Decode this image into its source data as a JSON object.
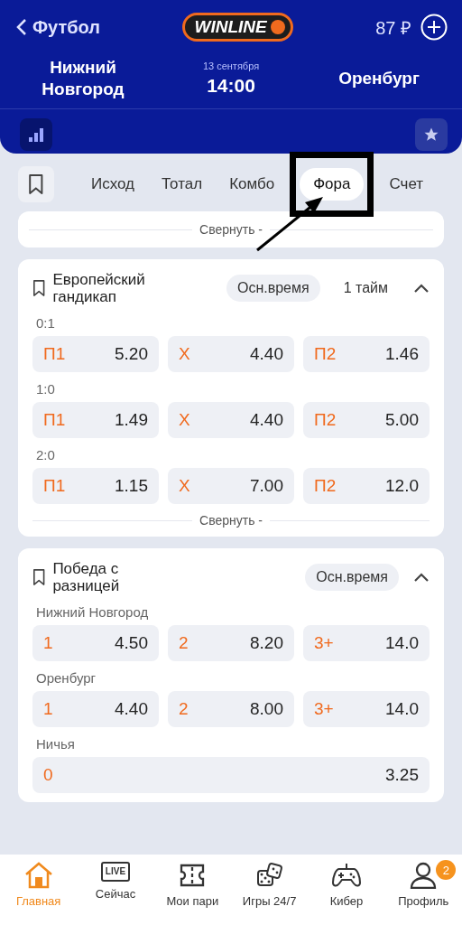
{
  "header": {
    "back_label": "Футбол",
    "logo": "WINLINE",
    "balance": "87 ₽",
    "home_team": "Нижний Новгород",
    "date": "13 сентября",
    "time": "14:00",
    "away_team": "Оренбург"
  },
  "tabs": [
    {
      "label": "Исход",
      "selected": false
    },
    {
      "label": "Тотал",
      "selected": false
    },
    {
      "label": "Комбо",
      "selected": false
    },
    {
      "label": "Фора",
      "selected": true
    },
    {
      "label": "Счет",
      "selected": false
    }
  ],
  "collapsed_card": {
    "collapse_label": "Свернуть -"
  },
  "markets": [
    {
      "title": "Европейский гандикап",
      "expanded": true,
      "periods": [
        {
          "label": "Осн.время",
          "selected": true
        },
        {
          "label": "1 тайм",
          "selected": false
        }
      ],
      "collapse_label": "Свернуть -",
      "groups": [
        {
          "label": "0:1",
          "outcomes": [
            {
              "name": "П1",
              "odd": "5.20"
            },
            {
              "name": "Х",
              "odd": "4.40"
            },
            {
              "name": "П2",
              "odd": "1.46"
            }
          ]
        },
        {
          "label": "1:0",
          "outcomes": [
            {
              "name": "П1",
              "odd": "1.49"
            },
            {
              "name": "Х",
              "odd": "4.40"
            },
            {
              "name": "П2",
              "odd": "5.00"
            }
          ]
        },
        {
          "label": "2:0",
          "outcomes": [
            {
              "name": "П1",
              "odd": "1.15"
            },
            {
              "name": "Х",
              "odd": "7.00"
            },
            {
              "name": "П2",
              "odd": "12.0"
            }
          ]
        }
      ]
    },
    {
      "title": "Победа с разницей",
      "expanded": true,
      "periods": [
        {
          "label": "Осн.время",
          "selected": true
        }
      ],
      "groups": [
        {
          "label": "Нижний Новгород",
          "outcomes": [
            {
              "name": "1",
              "odd": "4.50"
            },
            {
              "name": "2",
              "odd": "8.20"
            },
            {
              "name": "3+",
              "odd": "14.0"
            }
          ]
        },
        {
          "label": "Оренбург",
          "outcomes": [
            {
              "name": "1",
              "odd": "4.40"
            },
            {
              "name": "2",
              "odd": "8.00"
            },
            {
              "name": "3+",
              "odd": "14.0"
            }
          ]
        },
        {
          "label": "Ничья",
          "outcomes": [
            {
              "name": "0",
              "odd": "3.25"
            }
          ]
        }
      ]
    }
  ],
  "nav": [
    {
      "label": "Главная",
      "selected": true
    },
    {
      "label": "Сейчас",
      "selected": false,
      "icon_text": "LIVE"
    },
    {
      "label": "Мои пари",
      "selected": false
    },
    {
      "label": "Игры 24/7",
      "selected": false
    },
    {
      "label": "Кибер",
      "selected": false
    },
    {
      "label": "Профиль",
      "selected": false,
      "badge": "2"
    }
  ]
}
